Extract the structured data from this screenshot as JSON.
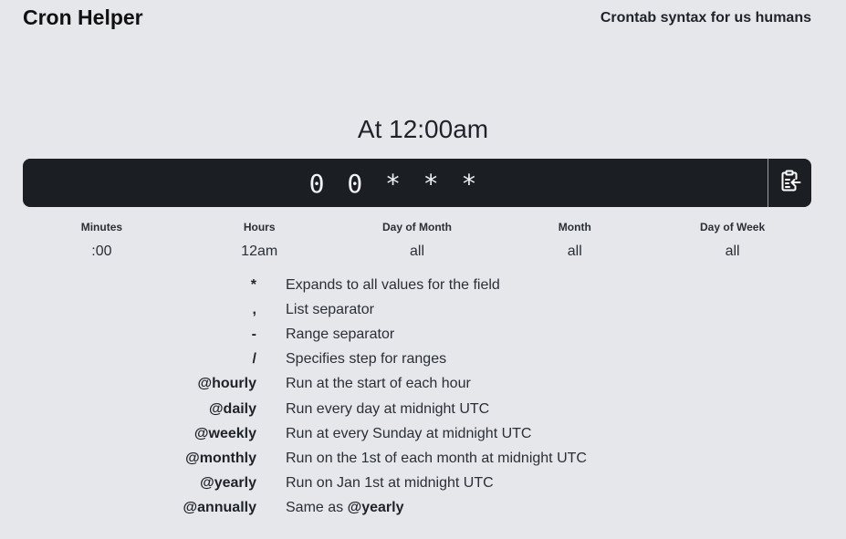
{
  "header": {
    "title": "Cron Helper",
    "tagline": "Crontab syntax for us humans"
  },
  "description": "At 12:00am",
  "cron": {
    "expression": "0 0 * * *",
    "copy_icon": "clipboard-copy-icon"
  },
  "fields": [
    {
      "label": "Minutes",
      "value": ":00"
    },
    {
      "label": "Hours",
      "value": "12am"
    },
    {
      "label": "Day of Month",
      "value": "all"
    },
    {
      "label": "Month",
      "value": "all"
    },
    {
      "label": "Day of Week",
      "value": "all"
    }
  ],
  "legend": [
    {
      "key": "*",
      "desc": "Expands to all values for the field"
    },
    {
      "key": ",",
      "desc": "List separator"
    },
    {
      "key": "-",
      "desc": "Range separator"
    },
    {
      "key": "/",
      "desc": "Specifies step for ranges"
    },
    {
      "key": "@hourly",
      "desc": "Run at the start of each hour"
    },
    {
      "key": "@daily",
      "desc": "Run every day at midnight UTC"
    },
    {
      "key": "@weekly",
      "desc": "Run at every Sunday at midnight UTC"
    },
    {
      "key": "@monthly",
      "desc": "Run on the 1st of each month at midnight UTC"
    },
    {
      "key": "@yearly",
      "desc": "Run on Jan 1st at midnight UTC"
    },
    {
      "key": "@annually",
      "desc": "Same as",
      "desc_bold": "@yearly"
    }
  ],
  "colors": {
    "background": "#e5e7eb",
    "bar": "#1b1f24",
    "bar_text": "#f1f3f5"
  }
}
